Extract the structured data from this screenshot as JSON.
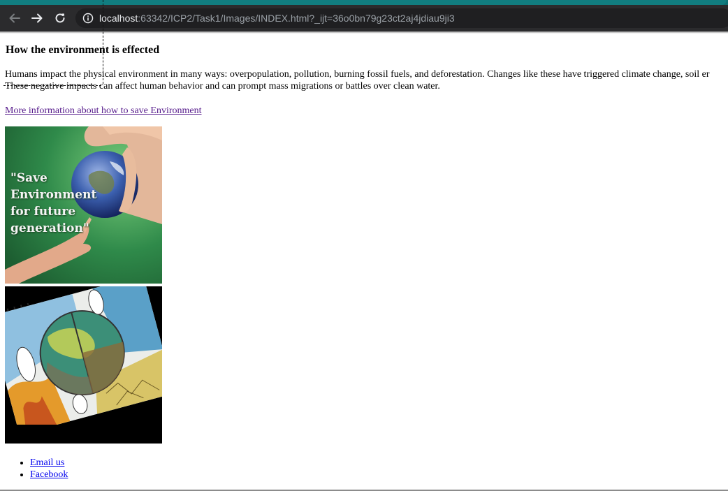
{
  "browser": {
    "url_host": "localhost",
    "url_rest": ":63342/ICP2/Task1/Images/INDEX.html?_ijt=36o0bn79g23ct2aj4jdiau9ji3",
    "icons": [
      "back-arrow-icon",
      "forward-arrow-icon",
      "reload-icon",
      "info-icon"
    ],
    "colors": {
      "tabstrip": "#0d6f73",
      "toolbar": "#2b2b2d",
      "omnibox": "#1f1f21"
    }
  },
  "page": {
    "heading": "How the environment is effected",
    "paragraph": {
      "line1": "Humans impact the physical environment in many ways: overpopulation, pollution, burning fossil fuels, and deforestation. Changes like these have triggered climate change, soil er",
      "line2": "These negative impacts can affect human behavior and can prompt mass migrations or battles over clean water."
    },
    "link_text": "More information about how to save Environment",
    "image1": {
      "caption": "\"Save\nEnvironment\nfor future\ngeneration\""
    },
    "footer_links": [
      "Email us",
      "Facebook"
    ],
    "colors": {
      "visited_link": "#551a8b",
      "link": "#0000ee"
    }
  }
}
